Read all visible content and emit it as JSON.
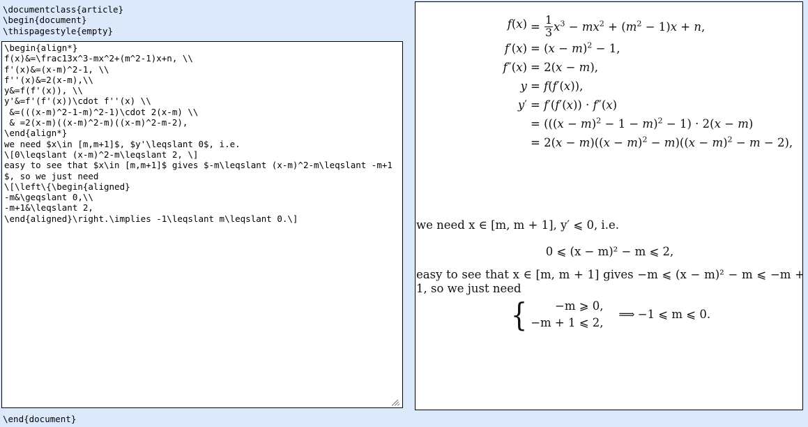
{
  "app": {
    "background_color": "#dce9fb",
    "panel_background": "#ffffff",
    "border_color": "#000000"
  },
  "editor": {
    "name": "latex-source-editor",
    "preamble_lines": [
      "\\documentclass{article}",
      "\\begin{document}",
      "\\thispagestyle{empty}"
    ],
    "postamble_lines": [
      "\\end{document}"
    ],
    "textarea_value": "\\begin{align*}\nf(x)&=\\frac13x^3-mx^2+(m^2-1)x+n, \\\\\nf'(x)&=(x-m)^2-1, \\\\\nf''(x)&=2(x-m),\\\\\ny&=f(f'(x)), \\\\\ny'&=f'(f'(x))\\cdot f''(x) \\\\\n &=(((x-m)^2-1-m)^2-1)\\cdot 2(x-m) \\\\\n & =2(x-m)((x-m)^2-m)((x-m)^2-m-2),\n\\end{align*}\nwe need $x\\in [m,m+1]$, $y'\\leqslant 0$, i.e.\n\\[0\\leqslant (x-m)^2-m\\leqslant 2, \\]\neasy to see that $x\\in [m,m+1]$ gives $-m\\leqslant (x-m)^2-m\\leqslant -m+1$, so we just need\n\\[\\left\\{\\begin{aligned}\n-m&\\geqslant 0,\\\\\n-m+1&\\leqslant 2,\n\\end{aligned}\\right.\\implies -1\\leqslant m\\leqslant 0.\\]",
    "placeholder": "",
    "resize_grip": "resize-handle"
  },
  "preview": {
    "name": "rendered-latex-preview",
    "align_block": [
      {
        "lhs": "f(x)",
        "rhs_prefix": "=",
        "rhs": "x³ − mx² + (m² − 1)x + n,",
        "frac_num": "1",
        "frac_den": "3"
      },
      {
        "lhs": "f′(x)",
        "rhs": "= (x − m)² − 1,"
      },
      {
        "lhs": "f″(x)",
        "rhs": "= 2(x − m),"
      },
      {
        "lhs": "y",
        "rhs": "= f(f′(x)),"
      },
      {
        "lhs": "y′",
        "rhs": "= f′(f′(x)) · f″(x)"
      },
      {
        "lhs": "",
        "rhs": "= (((x − m)² − 1 − m)² − 1) · 2(x − m)"
      },
      {
        "lhs": "",
        "rhs": "= 2(x − m)((x − m)² − m)((x − m)² − m − 2),"
      }
    ],
    "paragraph_we_need": "we need x ∈ [m, m + 1], y′ ⩽ 0, i.e.",
    "display_bounds": "0 ⩽ (x − m)² − m ⩽ 2,",
    "paragraph_easy": "easy to see that x ∈ [m, m + 1] gives −m ⩽ (x − m)² − m ⩽ −m + 1, so we just need",
    "cases": {
      "row1": "−m ⩾ 0,",
      "row2": "−m + 1 ⩽ 2,",
      "implies_arrow": "⟹",
      "conclusion": "−1 ⩽ m ⩽ 0."
    }
  }
}
